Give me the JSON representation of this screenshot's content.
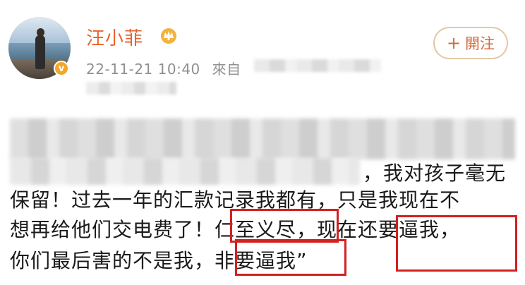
{
  "post": {
    "username": "汪小菲",
    "timestamp": "22-11-21 10:40",
    "source_prefix": "來自",
    "follow_label": "閞注",
    "follow_plus": "+",
    "verified_badge": "v",
    "lines": {
      "line1": "，我对孩子毫无",
      "line2": "保留！过去一年的汇款记录我都有，只是我现在不",
      "line3": "想再给他们交电费了！仁至义尽，现在还要逼我，",
      "line4": "你们最后害的不是我，非要逼我"
    },
    "line4_tail": "”"
  },
  "colors": {
    "username": "#e8632d",
    "follow_border": "#e2c9a4",
    "follow_text": "#d4683a",
    "highlight_box": "#d32020",
    "meta_text": "#8f8f8f",
    "badge": "#f5a623"
  },
  "icons": [
    "avatar",
    "verified-badge-icon",
    "crown-icon",
    "plus-icon"
  ]
}
